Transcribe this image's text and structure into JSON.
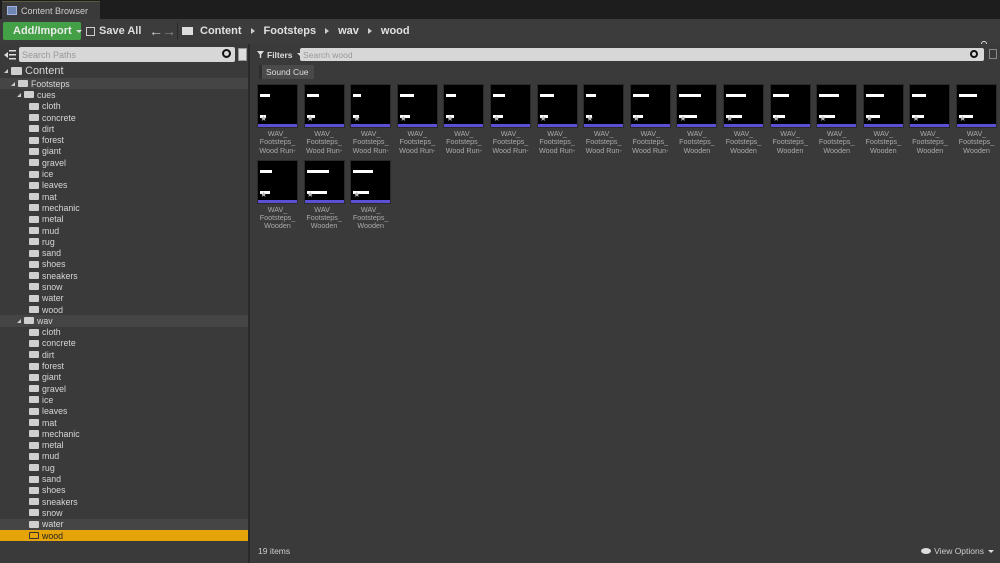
{
  "window": {
    "tab_title": "Content Browser"
  },
  "toolbar": {
    "add_import": "Add/Import",
    "save_all": "Save All",
    "back_icon": "←",
    "forward_icon": "→",
    "breadcrumb": [
      "Content",
      "Footsteps",
      "wav",
      "wood"
    ]
  },
  "sources": {
    "search_placeholder": "Search Paths",
    "tree": [
      {
        "label": "Content",
        "level": 0,
        "expanded": true,
        "root": true
      },
      {
        "label": "Footsteps",
        "level": 1,
        "expanded": true,
        "highlight": true
      },
      {
        "label": "cues",
        "level": 2,
        "expanded": true
      },
      {
        "label": "cloth",
        "level": 3
      },
      {
        "label": "concrete",
        "level": 3
      },
      {
        "label": "dirt",
        "level": 3
      },
      {
        "label": "forest",
        "level": 3
      },
      {
        "label": "giant",
        "level": 3
      },
      {
        "label": "gravel",
        "level": 3
      },
      {
        "label": "ice",
        "level": 3
      },
      {
        "label": "leaves",
        "level": 3
      },
      {
        "label": "mat",
        "level": 3
      },
      {
        "label": "mechanic",
        "level": 3
      },
      {
        "label": "metal",
        "level": 3
      },
      {
        "label": "mud",
        "level": 3
      },
      {
        "label": "rug",
        "level": 3
      },
      {
        "label": "sand",
        "level": 3
      },
      {
        "label": "shoes",
        "level": 3
      },
      {
        "label": "sneakers",
        "level": 3
      },
      {
        "label": "snow",
        "level": 3
      },
      {
        "label": "water",
        "level": 3
      },
      {
        "label": "wood",
        "level": 3
      },
      {
        "label": "wav",
        "level": 2,
        "expanded": true,
        "highlight": true
      },
      {
        "label": "cloth",
        "level": 3
      },
      {
        "label": "concrete",
        "level": 3
      },
      {
        "label": "dirt",
        "level": 3
      },
      {
        "label": "forest",
        "level": 3
      },
      {
        "label": "giant",
        "level": 3
      },
      {
        "label": "gravel",
        "level": 3
      },
      {
        "label": "ice",
        "level": 3
      },
      {
        "label": "leaves",
        "level": 3
      },
      {
        "label": "mat",
        "level": 3
      },
      {
        "label": "mechanic",
        "level": 3
      },
      {
        "label": "metal",
        "level": 3
      },
      {
        "label": "mud",
        "level": 3
      },
      {
        "label": "rug",
        "level": 3
      },
      {
        "label": "sand",
        "level": 3
      },
      {
        "label": "shoes",
        "level": 3
      },
      {
        "label": "sneakers",
        "level": 3
      },
      {
        "label": "snow",
        "level": 3
      },
      {
        "label": "water",
        "level": 3,
        "highlight": true
      },
      {
        "label": "wood",
        "level": 3,
        "selected": true
      }
    ]
  },
  "assets": {
    "filters_label": "Filters",
    "search_placeholder": "Search wood",
    "active_filter": "Sound Cue",
    "items": [
      {
        "caption": [
          "WAV_",
          "Footsteps_",
          "Wood Run-"
        ]
      },
      {
        "caption": [
          "WAV_",
          "Footsteps_",
          "Wood Run-"
        ]
      },
      {
        "caption": [
          "WAV_",
          "Footsteps_",
          "Wood Run-"
        ]
      },
      {
        "caption": [
          "WAV_",
          "Footsteps_",
          "Wood Run-"
        ]
      },
      {
        "caption": [
          "WAV_",
          "Footsteps_",
          "Wood Run-"
        ]
      },
      {
        "caption": [
          "WAV_",
          "Footsteps_",
          "Wood Run-"
        ]
      },
      {
        "caption": [
          "WAV_",
          "Footsteps_",
          "Wood Run-"
        ]
      },
      {
        "caption": [
          "WAV_",
          "Footsteps_",
          "Wood Run-"
        ]
      },
      {
        "caption": [
          "WAV_",
          "Footsteps_",
          "Wood Run-"
        ]
      },
      {
        "caption": [
          "WAV_",
          "Footsteps_",
          "Wooden"
        ]
      },
      {
        "caption": [
          "WAV_",
          "Footsteps_",
          "Wooden"
        ]
      },
      {
        "caption": [
          "WAV_",
          "Footsteps_",
          "Wooden"
        ]
      },
      {
        "caption": [
          "WAV_",
          "Footsteps_",
          "Wooden"
        ]
      },
      {
        "caption": [
          "WAV_",
          "Footsteps_",
          "Wooden"
        ]
      },
      {
        "caption": [
          "WAV_",
          "Footsteps_",
          "Wooden"
        ]
      },
      {
        "caption": [
          "WAV_",
          "Footsteps_",
          "Wooden"
        ]
      },
      {
        "caption": [
          "WAV_",
          "Footsteps_",
          "Wooden"
        ]
      },
      {
        "caption": [
          "WAV_",
          "Footsteps_",
          "Wooden"
        ]
      },
      {
        "caption": [
          "WAV_",
          "Footsteps_",
          "Wooden"
        ]
      }
    ],
    "item_count": "19 items",
    "view_options": "View Options"
  },
  "colors": {
    "accent_selected": "#e5a50a",
    "add_button": "#43a047",
    "thumb_bar": "#5b4fd4"
  }
}
